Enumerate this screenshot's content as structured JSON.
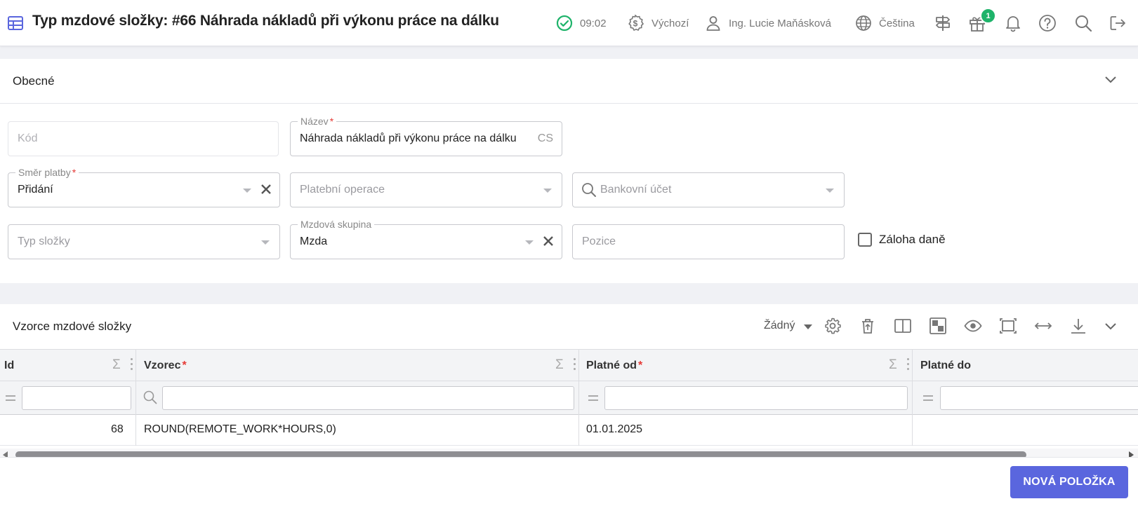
{
  "header": {
    "title": "Typ mzdové složky: #66 Náhrada nákladů při výkonu práce na dálku",
    "time": "09:02",
    "currency": "Výchozí",
    "user": "Ing. Lucie Maňásková",
    "language": "Čeština",
    "gift_badge": "1",
    "icons": [
      "table-icon",
      "check-circle-icon",
      "currency-icon",
      "user-icon",
      "globe-icon",
      "signpost-icon",
      "gift-icon",
      "bell-icon",
      "help-icon",
      "search-icon",
      "logout-icon"
    ],
    "colors": {
      "accent": "#5a66de",
      "ok": "#1eb36a"
    }
  },
  "general": {
    "title": "Obecné",
    "kod": {
      "placeholder": "Kód"
    },
    "nazev": {
      "label": "Název",
      "value": "Náhrada nákladů při výkonu práce na dálku",
      "suffix": "CS"
    },
    "smer_platby": {
      "label": "Směr platby",
      "value": "Přidání"
    },
    "platebni_operace": {
      "placeholder": "Platební operace"
    },
    "bankovni_ucet": {
      "placeholder": "Bankovní účet"
    },
    "typ_slozky": {
      "placeholder": "Typ složky"
    },
    "mzdova_skupina": {
      "label": "Mzdová skupina",
      "value": "Mzda"
    },
    "pozice": {
      "placeholder": "Pozice"
    },
    "zaloha_dane": {
      "label": "Záloha daně",
      "checked": false
    },
    "required_mark": "*"
  },
  "formulas": {
    "title": "Vzorce mzdové složky",
    "preset": "Žádný",
    "columns": [
      {
        "label": "Id",
        "required": false
      },
      {
        "label": "Vzorec",
        "required": true
      },
      {
        "label": "Platné od",
        "required": true
      },
      {
        "label": "Platné do",
        "required": false
      }
    ],
    "rows": [
      {
        "id": "68",
        "vzorec": "ROUND(REMOTE_WORK*HOURS,0)",
        "platne_od": "01.01.2025",
        "platne_do": ""
      }
    ],
    "new_button": "NOVÁ POLOŽKA"
  }
}
